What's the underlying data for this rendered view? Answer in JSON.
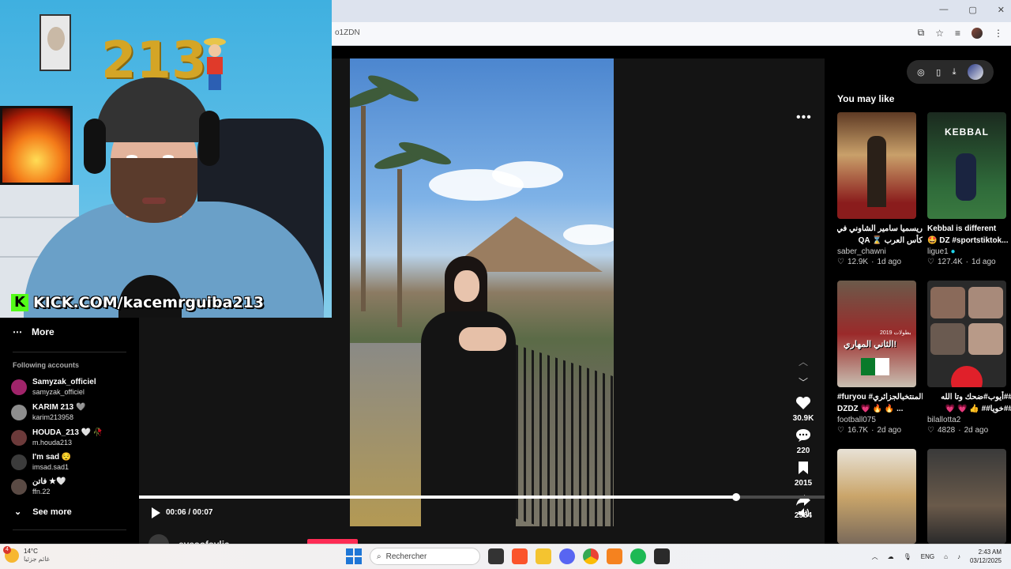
{
  "browser": {
    "url": "o1ZDN",
    "window_controls": [
      "—",
      "▢",
      "✕"
    ]
  },
  "sidebar": {
    "more_label": "More",
    "following_header": "Following accounts",
    "accounts": [
      {
        "name": "Samyzak_officiel",
        "user": "samyzak_officiel",
        "color": "#a0246a"
      },
      {
        "name": "KARIM 213 🩶",
        "user": "karim213958",
        "color": "#8d8d8d"
      },
      {
        "name": "HOUDA_213 🤍 🥀",
        "user": "m.houda213",
        "color": "#6c3a3a"
      },
      {
        "name": "I'm sad 😌",
        "user": "imsad.sad1",
        "color": "#3b3b3b"
      },
      {
        "name": "فاتن ★🤍",
        "user": "ffn.22",
        "color": "#5a4a44"
      }
    ],
    "see_more_label": "See more"
  },
  "webcam": {
    "balloon_text": "213",
    "overlay_text": "KICK.COM/kacemrguiba213",
    "kick_letter": "K"
  },
  "player": {
    "time_display": "00:06 / 00:07",
    "progress_fraction": 0.871,
    "author_partial": "eyesofsylia",
    "stats": {
      "likes": "30.9K",
      "comments": "220",
      "bookmarks": "2015",
      "shares": "2964"
    }
  },
  "you_may_like": {
    "title": "You may like",
    "cards": [
      {
        "title_line1": "ريسميا سامير الشاوني في قطر",
        "title_line2": "كأس العرب ⌛ QA",
        "author": "saber_chawni",
        "likes": "12.9K",
        "age": "1d ago"
      },
      {
        "title_line1": "Kebbal is different",
        "title_line2": "🤩 DZ #sportstiktok...",
        "author": "ligue1",
        "likes": "127.4K",
        "age": "1d ago"
      },
      {
        "title_line1": "#furyou #المنتخبالجزائري",
        "title_line2": "DZDZ 💗 🔥 🔥 ...",
        "author": "football075",
        "likes": "16.7K",
        "age": "2d ago"
      },
      {
        "title_line1": "##أيوب#ضحك وتا الله",
        "title_line2": "##خويا## 👍 💗 💗",
        "author": "bilallotta2",
        "likes": "4828",
        "age": "2d ago"
      }
    ],
    "thumb_text_kebbal": "KEBBAL",
    "thumb_text_arabic": "الثاني المهاري!",
    "thumb_year": "بطولات 2019"
  },
  "taskbar": {
    "temp": "14°C",
    "weather_desc": "غائم جزئيا",
    "weather_badge": "4",
    "search_placeholder": "Rechercher",
    "lang": "ENG",
    "time": "2:43 AM",
    "date": "03/12/2025"
  },
  "colors": {
    "accent": "#fe2c55",
    "kick_green": "#53fc18",
    "verified": "#20d5ec"
  }
}
